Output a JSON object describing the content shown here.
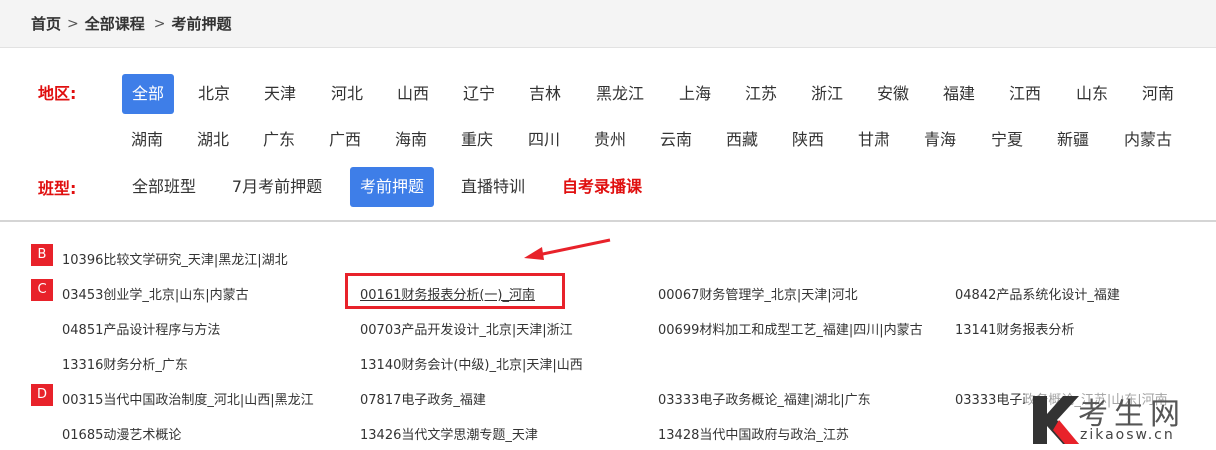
{
  "breadcrumb": {
    "home": "首页",
    "all_courses": "全部课程",
    "current": "考前押题",
    "sep": ">"
  },
  "region": {
    "label": "地区:",
    "row1": [
      "全部",
      "北京",
      "天津",
      "河北",
      "山西",
      "辽宁",
      "吉林",
      "黑龙江",
      "上海",
      "江苏",
      "浙江",
      "安徽",
      "福建",
      "江西",
      "山东",
      "河南"
    ],
    "row2": [
      "湖南",
      "湖北",
      "广东",
      "广西",
      "海南",
      "重庆",
      "四川",
      "贵州",
      "云南",
      "西藏",
      "陕西",
      "甘肃",
      "青海",
      "宁夏",
      "新疆",
      "内蒙古"
    ],
    "selected": "全部"
  },
  "class_type": {
    "label": "班型:",
    "options": [
      "全部班型",
      "7月考前押题",
      "考前押题",
      "直播特训",
      "自考录播课"
    ],
    "selected": "考前押题"
  },
  "groups": [
    {
      "letter": "B",
      "courses": [
        "10396比较文学研究_天津|黑龙江|湖北"
      ]
    },
    {
      "letter": "C",
      "courses": [
        "03453创业学_北京|山东|内蒙古",
        "00161财务报表分析(一)_河南",
        "00067财务管理学_北京|天津|河北",
        "04842产品系统化设计_福建",
        "04851产品设计程序与方法",
        "00703产品开发设计_北京|天津|浙江",
        "00699材料加工和成型工艺_福建|四川|内蒙古",
        "13141财务报表分析",
        "13316财务分析_广东",
        "13140财务会计(中级)_北京|天津|山西"
      ]
    },
    {
      "letter": "D",
      "courses": [
        "00315当代中国政治制度_河北|山西|黑龙江",
        "07817电子政务_福建",
        "03333电子政务概论_福建|湖北|广东",
        "03333电子政务概论_江苏|山东|河南",
        "01685动漫艺术概论",
        "13426当代文学思潮专题_天津",
        "13428当代中国政府与政治_江苏"
      ]
    }
  ],
  "watermark": {
    "brand": "考生网",
    "url": "zikaosw.cn"
  },
  "colors": {
    "accent": "#3e7ee8",
    "red": "#e00f0f",
    "badge": "#e8222a"
  }
}
